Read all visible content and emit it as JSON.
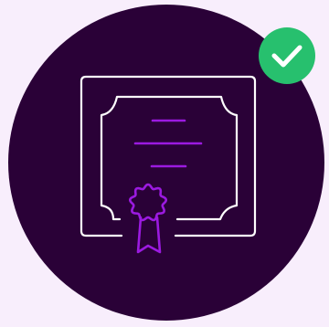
{
  "background_color": "#f8eefc",
  "circle_color": "#2a0137",
  "certificate_stroke_color": "#ffffff",
  "accent_color": "#9b1ae0",
  "check_badge_color": "#27c06e",
  "icons": {
    "certificate": "certificate-icon",
    "seal": "award-seal-icon",
    "check": "checkmark-icon"
  },
  "status": {
    "verified": true
  }
}
